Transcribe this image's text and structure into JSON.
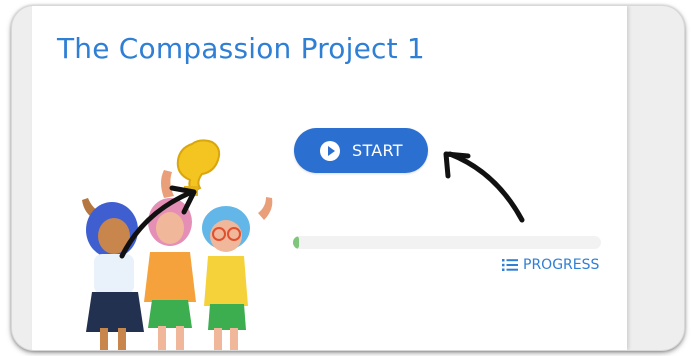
{
  "course": {
    "title": "The Compassion Project 1"
  },
  "actions": {
    "start_label": "START",
    "progress_label": "PROGRESS"
  },
  "progress": {
    "fraction": 0.02
  },
  "icons": {
    "play": "play-circle-icon",
    "list": "list-icon"
  },
  "colors": {
    "accent": "#2b6fd1",
    "title": "#2f7fd4",
    "progress_fill": "#7ec77a"
  }
}
